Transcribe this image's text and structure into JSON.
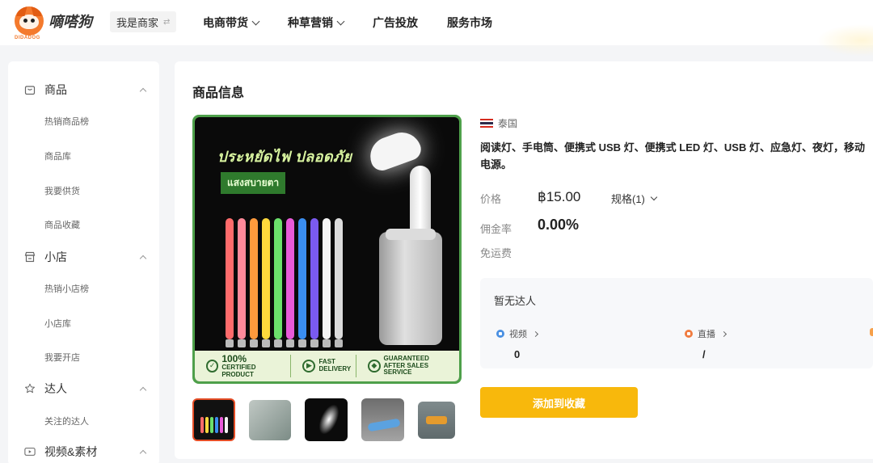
{
  "header": {
    "logo_text": "嘀嗒狗",
    "logo_sub": "DIDADOG",
    "role_switch": "我是商家",
    "nav": [
      {
        "label": "电商带货",
        "has_dropdown": true
      },
      {
        "label": "种草营销",
        "has_dropdown": true
      },
      {
        "label": "广告投放",
        "has_dropdown": false
      },
      {
        "label": "服务市场",
        "has_dropdown": false
      }
    ]
  },
  "sidebar": {
    "groups": [
      {
        "label": "商品",
        "icon": "bag-icon",
        "items": [
          "热销商品榜",
          "商品库",
          "我要供货",
          "商品收藏"
        ]
      },
      {
        "label": "小店",
        "icon": "store-icon",
        "items": [
          "热销小店榜",
          "小店库",
          "我要开店"
        ]
      },
      {
        "label": "达人",
        "icon": "star-user-icon",
        "items": [
          "关注的达人"
        ]
      },
      {
        "label": "视频&素材",
        "icon": "video-icon",
        "items": []
      }
    ]
  },
  "product": {
    "section_title": "商品信息",
    "image": {
      "thai_headline": "ประหยัดไฟ ปลอดภัย",
      "thai_chip": "แสงสบายตา",
      "badges": [
        {
          "big": "100%",
          "small": "CERTIFIED PRODUCT"
        },
        {
          "big": "FAST",
          "small": "DELIVERY"
        },
        {
          "big": "GUARANTEED",
          "small": "AFTER SALES SERVICE"
        }
      ]
    },
    "country": "泰国",
    "title": "阅读灯、手电筒、便携式 USB 灯、便携式 LED 灯、USB 灯、应急灯、夜灯，移动电源。",
    "price_label": "价格",
    "price": "฿15.00",
    "spec_label": "规格(1)",
    "commission_label": "佣金率",
    "commission": "0.00%",
    "shipping": "免运费",
    "influencers": {
      "title": "暂无达人",
      "video_label": "视频",
      "video_value": "0",
      "live_label": "直播",
      "live_value": "/"
    },
    "cta": "添加到收藏"
  },
  "colors": {
    "accent": "#f8b80c",
    "image_border": "#4ea04a",
    "active_thumb": "#e44d26",
    "video_dot": "#4a90e2",
    "live_dot": "#f07b3f"
  }
}
